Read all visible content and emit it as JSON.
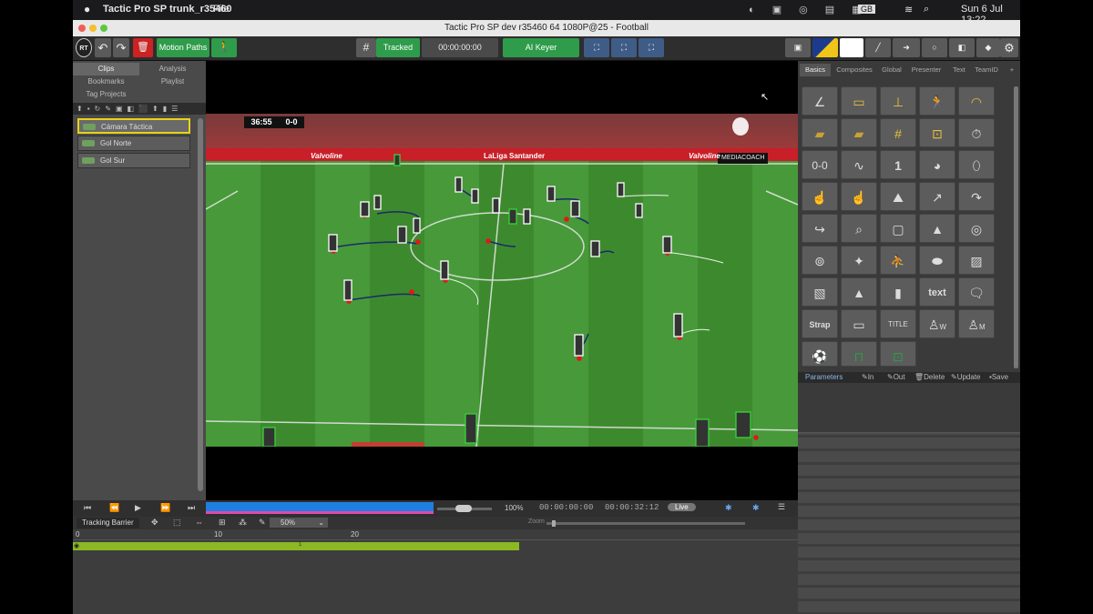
{
  "menubar": {
    "app_name": "Tactic Pro SP trunk_r35460",
    "file_menu": "File",
    "language": "GB",
    "datetime": "Sun 6 Jul 13:22"
  },
  "window": {
    "title": "Tactic Pro SP dev r35460 64 1080P@25 - Football"
  },
  "toolbar": {
    "motion_paths_label": "Motion Paths",
    "tracked_label": "Tracked",
    "timecode": "00:00:00:00",
    "ai_keyer_label": "AI Keyer"
  },
  "left_panel": {
    "tabs": [
      {
        "label": "Clips"
      },
      {
        "label": "Analysis"
      },
      {
        "label": "Bookmarks"
      },
      {
        "label": "Playlist"
      },
      {
        "label": "Tag Projects"
      }
    ],
    "clips": [
      {
        "label": "Cámara Táctica"
      },
      {
        "label": "Gol Norte"
      },
      {
        "label": "Gol Sur"
      }
    ]
  },
  "video": {
    "score_time": "36:55",
    "score": "0-0",
    "overlay_brand": "MEDIACOACH",
    "ad_boards": [
      "Valvoline",
      "LaLiga Santander",
      "Valvoline"
    ]
  },
  "right_panel": {
    "tabs": [
      {
        "label": "Basics"
      },
      {
        "label": "Composites"
      },
      {
        "label": "Global"
      },
      {
        "label": "Presenter"
      },
      {
        "label": "Text"
      },
      {
        "label": "TeamID"
      },
      {
        "label": "+"
      }
    ],
    "tool_text_labels": {
      "scoreboard": "0-0",
      "number": "1",
      "text": "text",
      "strap": "Strap",
      "title": "TITLE",
      "player_w": "W",
      "player_m": "M"
    },
    "params": {
      "title": "Parameters",
      "in": "In",
      "out": "Out",
      "delete": "Delete",
      "update": "Update",
      "save": "Save"
    }
  },
  "transport": {
    "speed": "100%",
    "timecode_in": "00:00:00:00",
    "timecode_dur": "00:00:32:12",
    "live_label": "Live"
  },
  "trackbar": {
    "tracking_barrier_label": "Tracking Barrier",
    "zoom_value": "50%",
    "zoom_label": "Zoom"
  },
  "timeline": {
    "ruler_marks": [
      "0",
      "10",
      "20"
    ],
    "bar_marker": "1"
  }
}
